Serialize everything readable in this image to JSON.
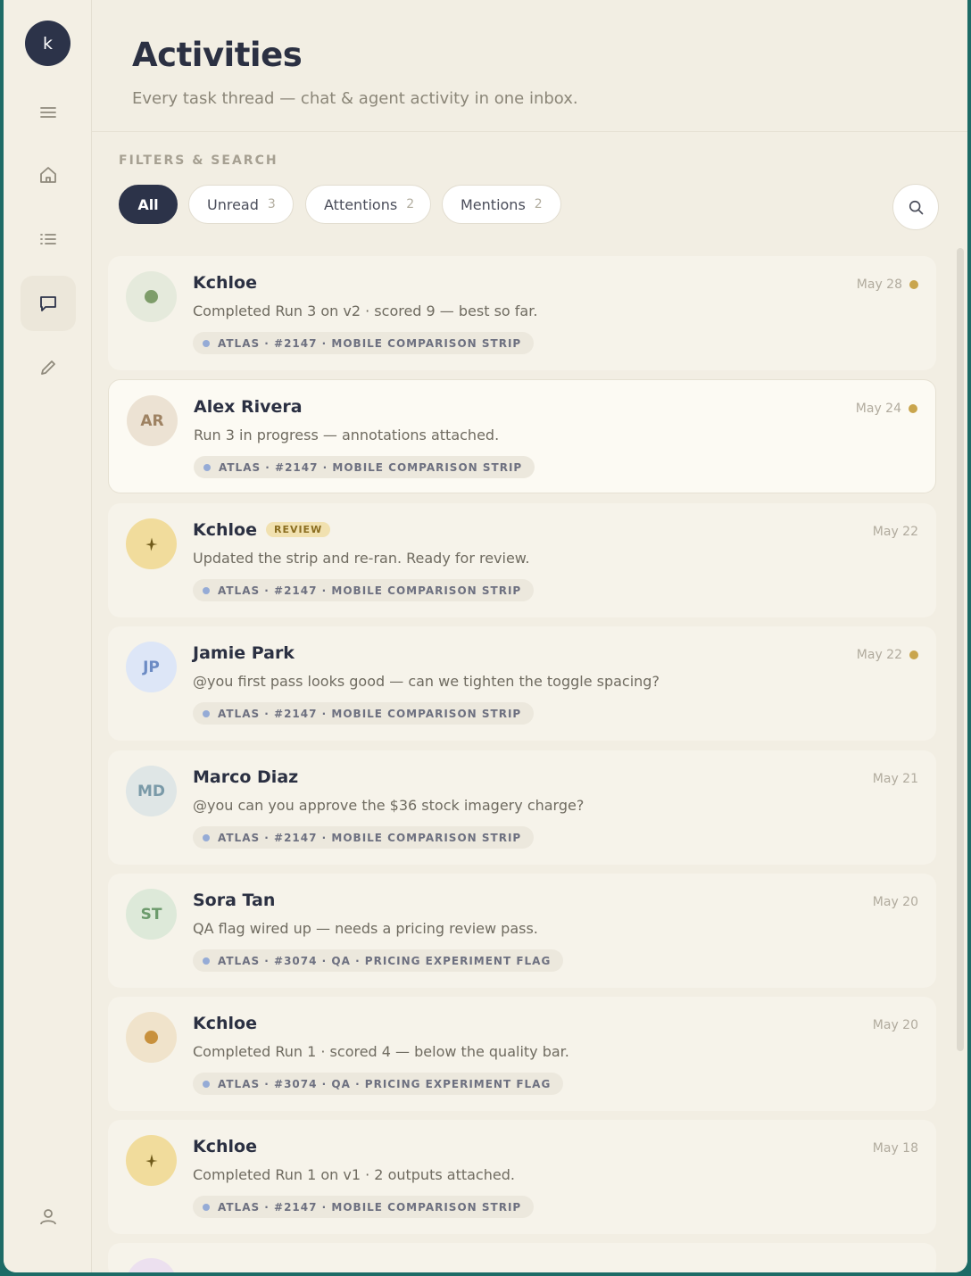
{
  "user": {
    "initial": "k"
  },
  "header": {
    "title": "Activities",
    "subtitle": "Every task thread — chat & agent activity in one inbox."
  },
  "filters": {
    "label": "FILTERS & SEARCH",
    "chips": [
      {
        "label": "All",
        "count": ""
      },
      {
        "label": "Unread",
        "count": "3"
      },
      {
        "label": "Attentions",
        "count": "2"
      },
      {
        "label": "Mentions",
        "count": "2"
      }
    ]
  },
  "colors": {
    "accent": "#2c3349",
    "unread_dot": "#c9a54d",
    "tag_dot": "#95abd6"
  },
  "activities": [
    {
      "name": "Kchloe",
      "avatar": "",
      "message": "Completed Run 3 on v2 · scored 9 — best so far.",
      "tag": "ATLAS · #2147 · MOBILE COMPARISON STRIP",
      "date": "May 28",
      "unread": true
    },
    {
      "name": "Alex Rivera",
      "avatar": "AR",
      "message": "Run 3 in progress — annotations attached.",
      "tag": "ATLAS · #2147 · MOBILE COMPARISON STRIP",
      "date": "May 24",
      "unread": true
    },
    {
      "name": "Kchloe",
      "badge": "REVIEW",
      "avatar": "",
      "message": "Updated the strip and re-ran. Ready for review.",
      "tag": "ATLAS · #2147 · MOBILE COMPARISON STRIP",
      "date": "May 22",
      "unread": false
    },
    {
      "name": "Jamie Park",
      "avatar": "JP",
      "message": "@you first pass looks good — can we tighten the toggle spacing?",
      "tag": "ATLAS · #2147 · MOBILE COMPARISON STRIP",
      "date": "May 22",
      "unread": true
    },
    {
      "name": "Marco Diaz",
      "avatar": "MD",
      "message": "@you can you approve the $36 stock imagery charge?",
      "tag": "ATLAS · #2147 · MOBILE COMPARISON STRIP",
      "date": "May 21",
      "unread": false
    },
    {
      "name": "Sora Tan",
      "avatar": "ST",
      "message": "QA flag wired up — needs a pricing review pass.",
      "tag": "ATLAS · #3074 · QA · PRICING EXPERIMENT FLAG",
      "date": "May 20",
      "unread": false
    },
    {
      "name": "Kchloe",
      "avatar": "",
      "message": "Completed Run 1 · scored 4 — below the quality bar.",
      "tag": "ATLAS · #3074 · QA · PRICING EXPERIMENT FLAG",
      "date": "May 20",
      "unread": false
    },
    {
      "name": "Kchloe",
      "avatar": "",
      "message": "Completed Run 1 on v1 · 2 outputs attached.",
      "tag": "ATLAS · #2147 · MOBILE COMPARISON STRIP",
      "date": "May 18",
      "unread": false
    }
  ]
}
